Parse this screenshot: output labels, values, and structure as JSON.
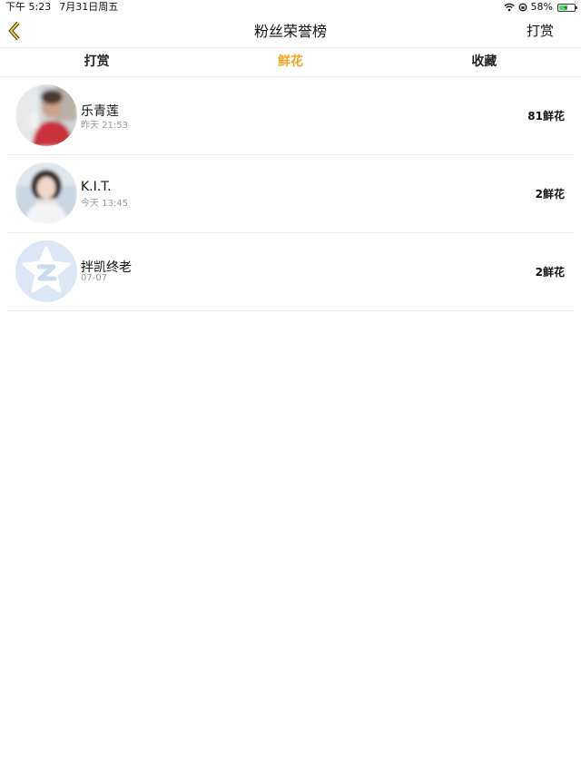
{
  "status_bar": {
    "time": "下午 5:23",
    "date": "7月31日周五",
    "battery_percent": "58%",
    "battery_level": 0.58,
    "icons": [
      "wifi-icon",
      "orientation-lock-icon",
      "battery-charging-icon"
    ]
  },
  "nav": {
    "title": "粉丝荣誉榜",
    "right_action": "打赏",
    "back_icon": "chevron-left-icon"
  },
  "tabs": [
    {
      "label": "打赏",
      "active": false
    },
    {
      "label": "鲜花",
      "active": true
    },
    {
      "label": "收藏",
      "active": false
    }
  ],
  "accent_color": "#f0a31e",
  "fans": [
    {
      "name": "乐青莲",
      "time": "昨天 21:53",
      "count": "81鲜花",
      "avatar": "photo-avatar-child"
    },
    {
      "name": "K.I.T.",
      "time": "今天 13:45",
      "count": "2鲜花",
      "avatar": "photo-avatar-woman"
    },
    {
      "name": "拌凯终老",
      "time": "07-07",
      "count": "2鲜花",
      "avatar": "default-qq-avatar"
    }
  ]
}
